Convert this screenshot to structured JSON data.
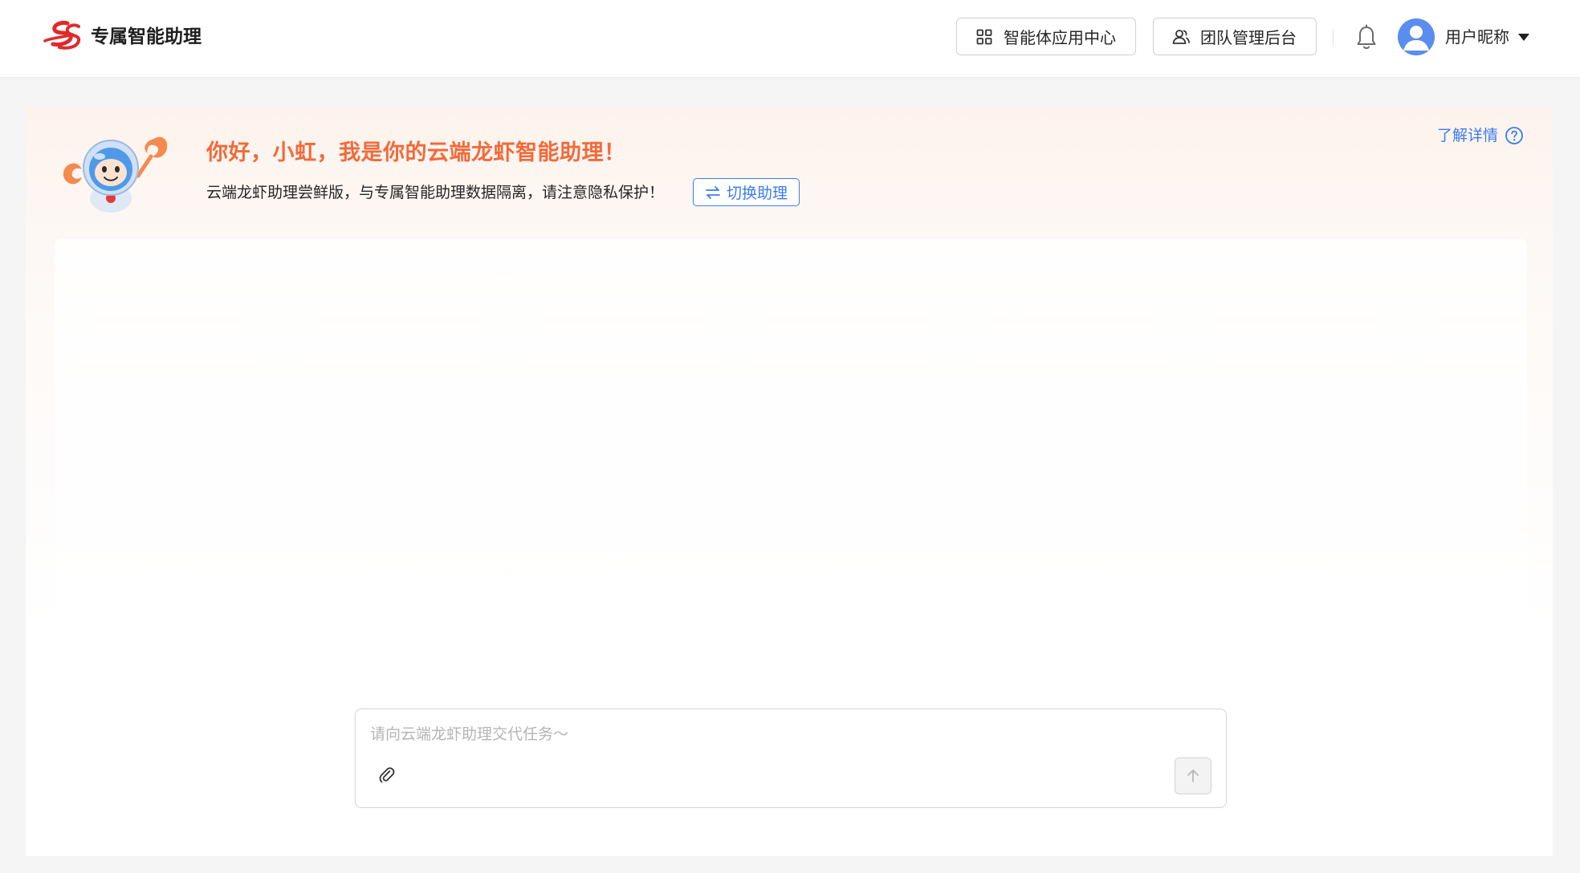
{
  "header": {
    "app_title": "专属智能助理",
    "apps_button_label": "智能体应用中心",
    "team_button_label": "团队管理后台",
    "username": "用户昵称"
  },
  "welcome": {
    "greeting": "你好，小虹，我是你的云端龙虾智能助理！",
    "subtitle": "云端龙虾助理尝鲜版，与专属智能助理数据隔离，请注意隐私保护！",
    "switch_label": "切换助理",
    "learn_more_label": "了解详情"
  },
  "composer": {
    "placeholder": "请向云端龙虾助理交代任务～",
    "value": ""
  },
  "colors": {
    "accent_orange": "#f26a3a",
    "link_blue": "#3b7cf0",
    "avatar_blue": "#5b8def"
  },
  "icons": {
    "logo": "brand-logo-icon",
    "apps": "grid-icon",
    "team": "users-icon",
    "notifications": "bell-icon",
    "avatar": "user-avatar-icon",
    "dropdown": "caret-down-icon",
    "switch": "swap-arrows-icon",
    "help": "question-circle-icon",
    "attach": "paperclip-icon",
    "send": "arrow-up-icon",
    "mascot": "lobster-mascot-icon"
  }
}
